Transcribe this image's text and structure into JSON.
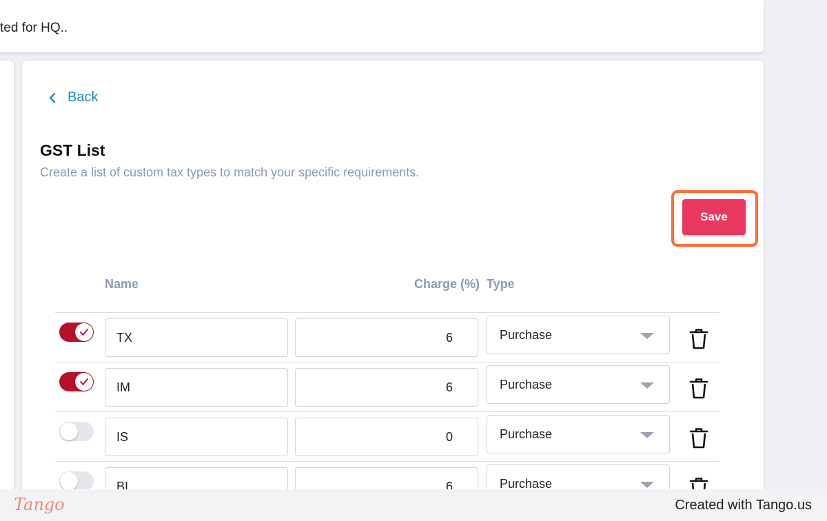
{
  "top_banner": {
    "text": "ted for HQ.."
  },
  "back": {
    "label": "Back"
  },
  "page": {
    "title": "GST List",
    "subtitle": "Create a list of custom tax types to match your specific requirements."
  },
  "save": {
    "label": "Save"
  },
  "table": {
    "headers": {
      "name": "Name",
      "charge": "Charge (%)",
      "type": "Type"
    },
    "rows": [
      {
        "enabled": true,
        "name": "TX",
        "charge": "6",
        "type": "Purchase"
      },
      {
        "enabled": true,
        "name": "IM",
        "charge": "6",
        "type": "Purchase"
      },
      {
        "enabled": false,
        "name": "IS",
        "charge": "0",
        "type": "Purchase"
      },
      {
        "enabled": false,
        "name": "BI",
        "charge": "6",
        "type": "Purchase"
      }
    ]
  },
  "footer": {
    "logo": "Tango",
    "credit": "Created with Tango.us"
  },
  "colors": {
    "accent": "#e8385f",
    "highlight": "#ff6d35",
    "toggle_on": "#b8102a",
    "link": "#1e88c8"
  },
  "icons": {
    "back": "chevron-left-icon",
    "delete": "trash-icon",
    "dropdown": "caret-down-icon",
    "toggle_on": "check-icon"
  }
}
